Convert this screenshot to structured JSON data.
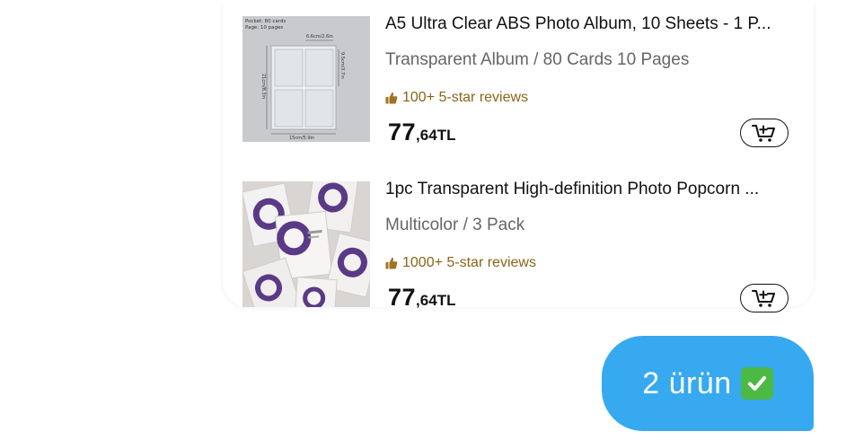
{
  "products": [
    {
      "title": "A5 Ultra Clear ABS Photo Album, 10 Sheets - 1 P...",
      "variant": "Transparent Album / 80 Cards 10 Pages",
      "reviews": "100+ 5-star reviews",
      "price_major": "77",
      "price_minor": ",64",
      "currency": "TL",
      "thumb_text": {
        "pocket": "Pocket:   80 cards",
        "page": "Page:  10 pages",
        "width_small": "6.6cm/2.6in",
        "height_small": "9.5cm/3.7in",
        "height_full": "21cm/8.3in",
        "width_full": "15cm/5.9in"
      }
    },
    {
      "title": "1pc Transparent High-definition Photo Popcorn ...",
      "variant": "Multicolor / 3 Pack",
      "reviews": "1000+ 5-star reviews",
      "price_major": "77",
      "price_minor": ",64",
      "currency": "TL"
    }
  ],
  "chat_bubble": {
    "text": "2 ürün",
    "emoji_icon": "check-mark-button-icon"
  },
  "colors": {
    "bubble": "#36a9f0",
    "reviews_text": "#8a6418",
    "check_green": "#4cb944"
  },
  "icons": {
    "reviews": "thumbs-up-icon",
    "cart": "add-to-cart-icon"
  }
}
